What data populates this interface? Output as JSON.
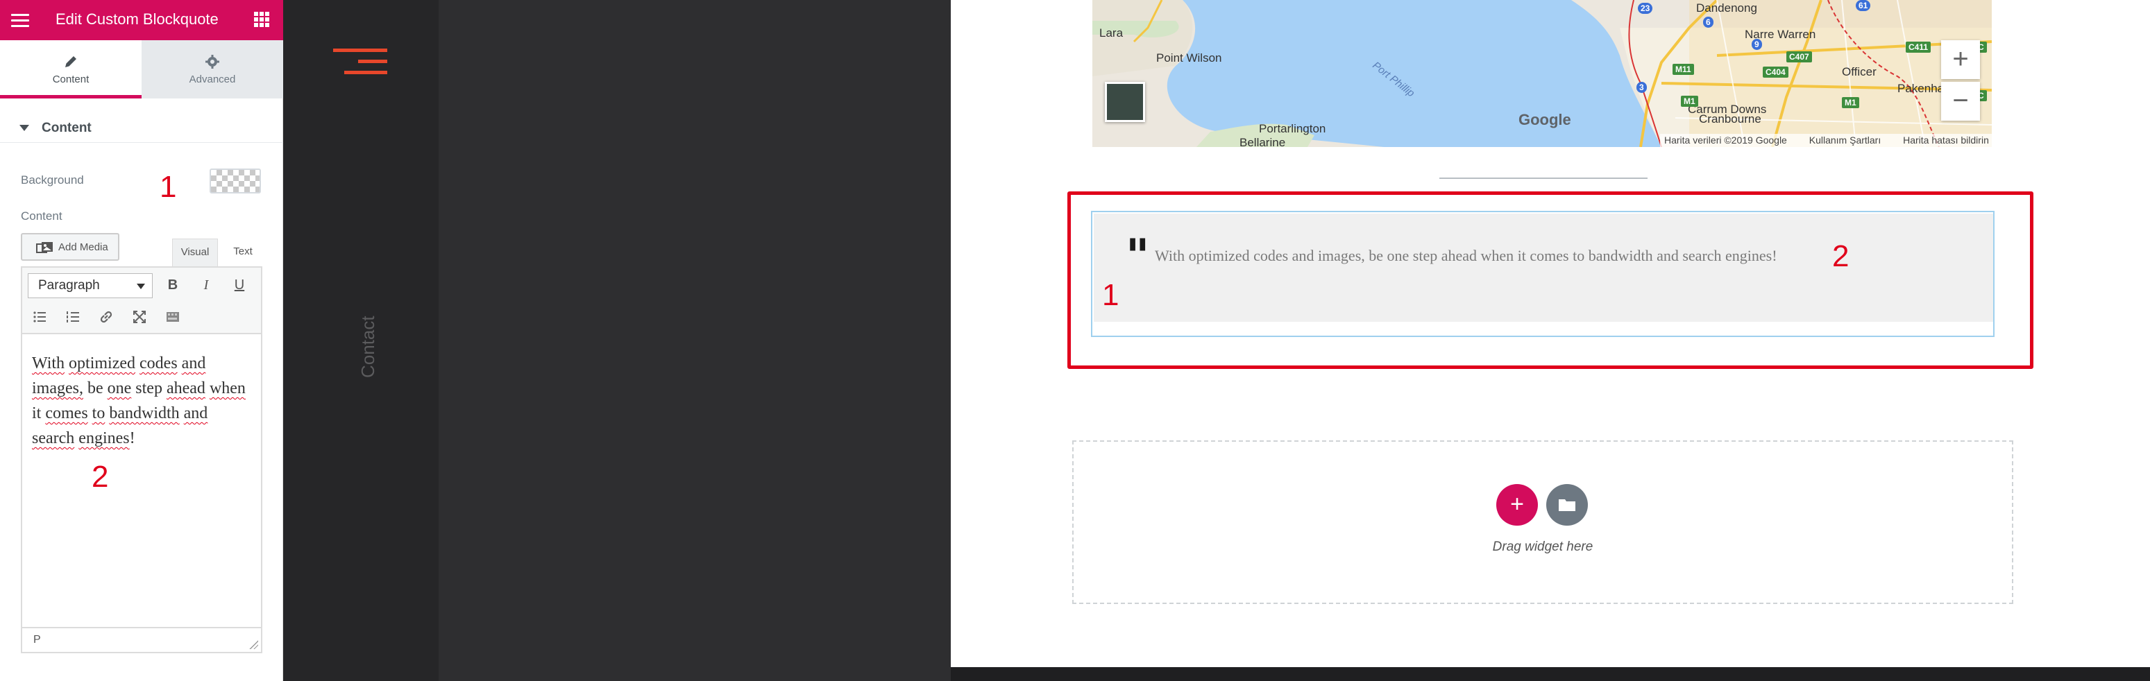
{
  "panel": {
    "title": "Edit Custom Blockquote",
    "tabs": [
      {
        "label": "Content",
        "icon": "pencil-icon",
        "active": true
      },
      {
        "label": "Advanced",
        "icon": "gear-icon",
        "active": false
      }
    ],
    "section_title": "Content",
    "background_label": "Background",
    "content_label": "Content",
    "add_media_label": "Add Media",
    "editor_tabs": {
      "visual": "Visual",
      "text": "Text"
    },
    "format_select": "Paragraph",
    "toolbar": {
      "bold": "B",
      "italic": "I",
      "underline": "U"
    },
    "editor_words": [
      "With",
      "optimized",
      "codes",
      "and",
      "images,",
      "be",
      "one",
      "step",
      "ahead",
      "when",
      "it",
      "comes",
      "to",
      "bandwidth",
      "and",
      "search",
      "engines",
      "!"
    ],
    "status_path": "P",
    "annotation_1": "1",
    "annotation_2": "2",
    "accent_color": "#d30c5c"
  },
  "sidebar": {
    "nav_link": "Contact",
    "logo_color": "#e8472b"
  },
  "map": {
    "labels": {
      "lara": "Lara",
      "point_wilson": "Point Wilson",
      "port_phillip": "Port Phillip",
      "portarlington": "Portarlington",
      "bellarine": "Bellarine",
      "carrum_downs": "Carrum Downs",
      "cranbourne": "Cranbourne",
      "officer": "Officer",
      "pakenham": "Pakenham",
      "narre_warren": "Narre Warren",
      "dandenong": "Dandenong"
    },
    "road_shields": [
      "M11",
      "C404",
      "C407",
      "C411",
      "M1",
      "M1",
      "23",
      "6",
      "9",
      "3",
      "61",
      "C",
      "C"
    ],
    "google": "Google",
    "attribution": [
      "Harita verileri ©2019 Google",
      "Kullanım Şartları",
      "Harita hatası bildirin"
    ],
    "zoom_in": "+",
    "zoom_out": "−"
  },
  "blockquote": {
    "quote_mark": "\"",
    "text": "With optimized codes and images, be one step ahead when it comes to bandwidth and search engines!",
    "annotation_1": "1",
    "annotation_2": "2",
    "highlight_color": "#e0001b"
  },
  "drop_zone": {
    "add_label": "+",
    "drag_text": "Drag widget here"
  }
}
